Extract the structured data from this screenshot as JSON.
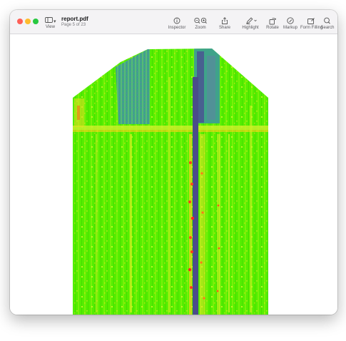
{
  "window": {
    "file_name": "report.pdf",
    "page_info": "Page 5 of 23"
  },
  "toolbar": {
    "view_label": "View",
    "items": [
      {
        "label": "Inspector",
        "icon": "info-icon"
      },
      {
        "label": "Zoom",
        "icon": "zoom-icon"
      },
      {
        "label": "Share",
        "icon": "share-icon"
      },
      {
        "label": "Highlight",
        "icon": "highlight-icon"
      },
      {
        "label": "Rotate",
        "icon": "rotate-icon"
      },
      {
        "label": "Markup",
        "icon": "markup-icon"
      },
      {
        "label": "Form Filling",
        "icon": "form-filling-icon"
      },
      {
        "label": "Search",
        "icon": "search-icon"
      }
    ]
  },
  "colors": {
    "close": "#fe5f57",
    "minimize": "#febc2e",
    "zoom": "#28c840",
    "field_green": "#52f000",
    "vegetation_yellow": "#d6f21c",
    "stress_red": "#ff3a1c",
    "bare_purple": "#4b4d8a"
  }
}
